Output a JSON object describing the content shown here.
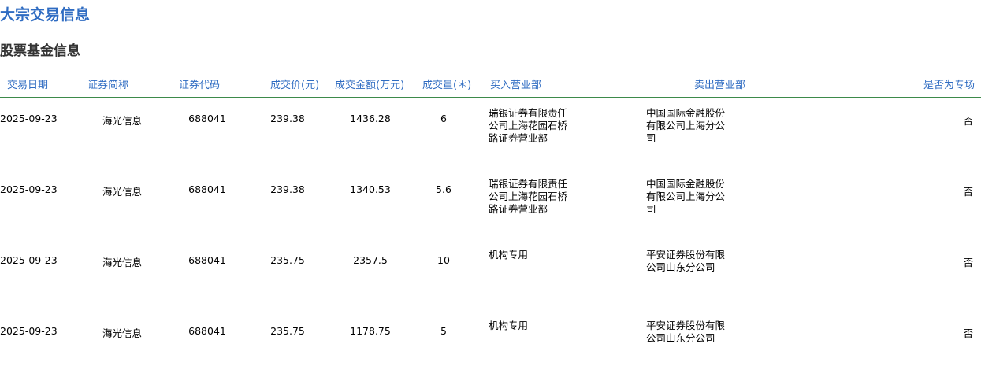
{
  "page": {
    "title": "大宗交易信息",
    "section_title": "股票基金信息"
  },
  "table": {
    "headers": {
      "date": "交易日期",
      "name": "证券简称",
      "code": "证券代码",
      "price": "成交价(元)",
      "amount": "成交金额(万元)",
      "volume": "成交量(＊)",
      "buyer": "买入营业部",
      "seller": "卖出营业部",
      "special": "是否为专场"
    },
    "rows": [
      {
        "date": "2025-09-23",
        "name": "海光信息",
        "code": "688041",
        "price": "239.38",
        "amount": "1436.28",
        "volume": "6",
        "buyer": "瑞银证券有限责任公司上海花园石桥路证券营业部",
        "seller": "中国国际金融股份有限公司上海分公司",
        "special": "否"
      },
      {
        "date": "2025-09-23",
        "name": "海光信息",
        "code": "688041",
        "price": "239.38",
        "amount": "1340.53",
        "volume": "5.6",
        "buyer": "瑞银证券有限责任公司上海花园石桥路证券营业部",
        "seller": "中国国际金融股份有限公司上海分公司",
        "special": "否"
      },
      {
        "date": "2025-09-23",
        "name": "海光信息",
        "code": "688041",
        "price": "235.75",
        "amount": "2357.5",
        "volume": "10",
        "buyer": "机构专用",
        "seller": "平安证券股份有限公司山东分公司",
        "special": "否"
      },
      {
        "date": "2025-09-23",
        "name": "海光信息",
        "code": "688041",
        "price": "235.75",
        "amount": "1178.75",
        "volume": "5",
        "buyer": "机构专用",
        "seller": "平安证券股份有限公司山东分公司",
        "special": "否"
      }
    ]
  },
  "colors": {
    "title": "#2f6cc2",
    "header_text": "#2f6cc2",
    "header_rule": "#3d8a4a",
    "section_title": "#333333"
  }
}
